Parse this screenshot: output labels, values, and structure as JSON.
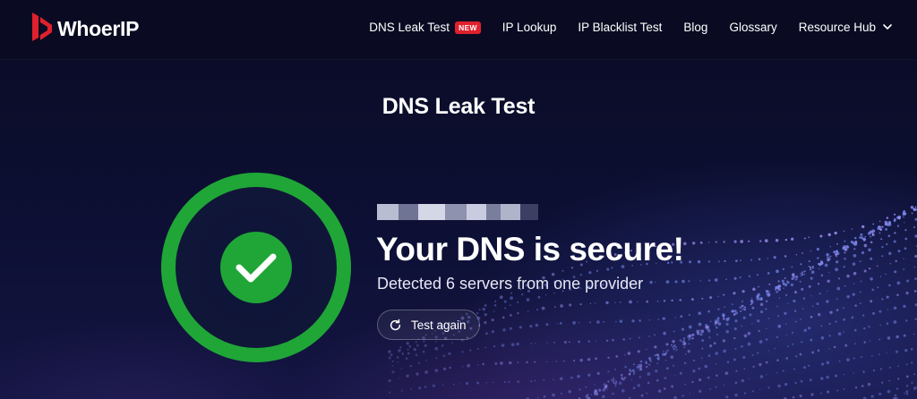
{
  "brand": {
    "name": "WhoerIP",
    "accent": "#e0202d"
  },
  "nav": {
    "items": [
      {
        "label": "DNS Leak Test",
        "badge": "NEW"
      },
      {
        "label": "IP Lookup"
      },
      {
        "label": "IP Blacklist Test"
      },
      {
        "label": "Blog"
      },
      {
        "label": "Glossary"
      },
      {
        "label": "Resource Hub",
        "icon": "chevron-down-icon"
      }
    ]
  },
  "page": {
    "title": "DNS Leak Test"
  },
  "result": {
    "headline": "Your DNS is secure!",
    "detail": "Detected 6 servers from one provider",
    "status_color": "#1fa637",
    "status_icon": "check-icon",
    "retest_label": "Test again",
    "retest_icon": "refresh-icon"
  }
}
